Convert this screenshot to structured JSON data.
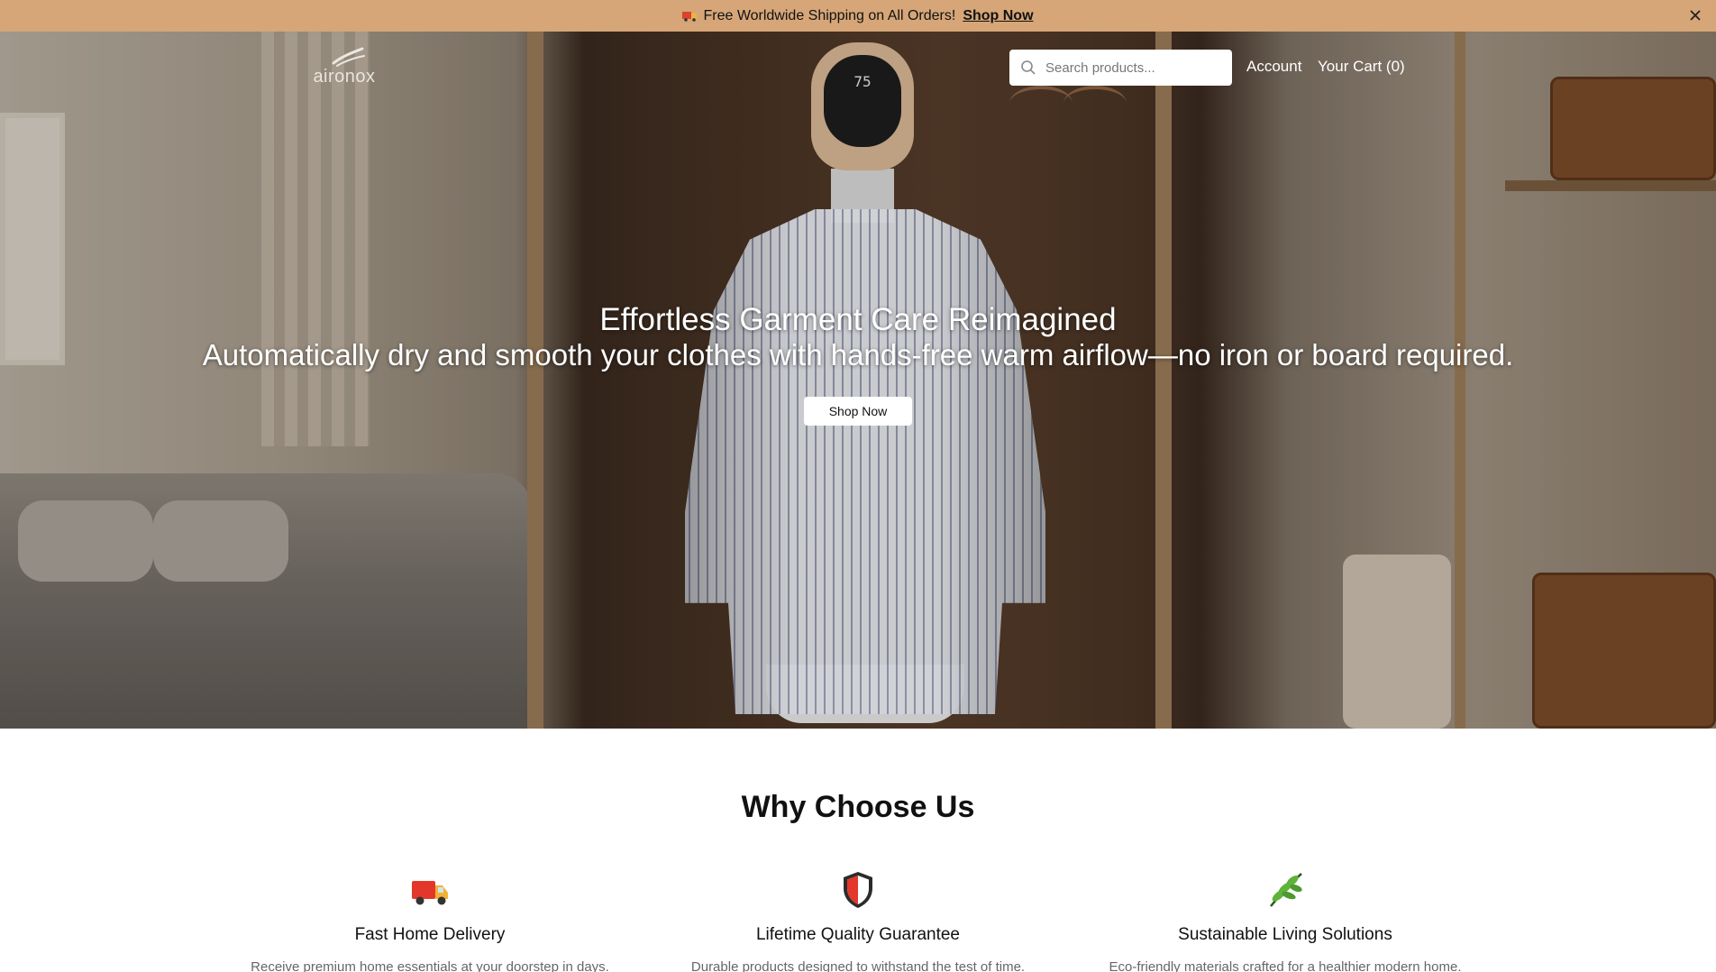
{
  "announcement": {
    "text": "Free Worldwide Shipping on All Orders!",
    "link_label": "Shop Now",
    "icon": "truck-icon",
    "close_icon": "close-icon"
  },
  "header": {
    "logo_text": "aironox",
    "search_placeholder": "Search products...",
    "account_label": "Account",
    "cart_label": "Your Cart (0)"
  },
  "hero": {
    "title": "Effortless Garment Care Reimagined",
    "subtitle": "Automatically dry and smooth your clothes with hands-free warm airflow—no iron or board required.",
    "button_label": "Shop Now",
    "device_display": "75"
  },
  "why": {
    "title": "Why Choose Us",
    "features": [
      {
        "icon": "delivery-truck-icon",
        "title": "Fast Home Delivery",
        "description": "Receive premium home essentials at your doorstep in days."
      },
      {
        "icon": "shield-icon",
        "title": "Lifetime Quality Guarantee",
        "description": "Durable products designed to withstand the test of time."
      },
      {
        "icon": "leaf-icon",
        "title": "Sustainable Living Solutions",
        "description": "Eco-friendly materials crafted for a healthier modern home."
      }
    ]
  },
  "colors": {
    "announcement_bg": "#d6a678",
    "text_primary": "#111111",
    "text_muted": "#666666"
  }
}
